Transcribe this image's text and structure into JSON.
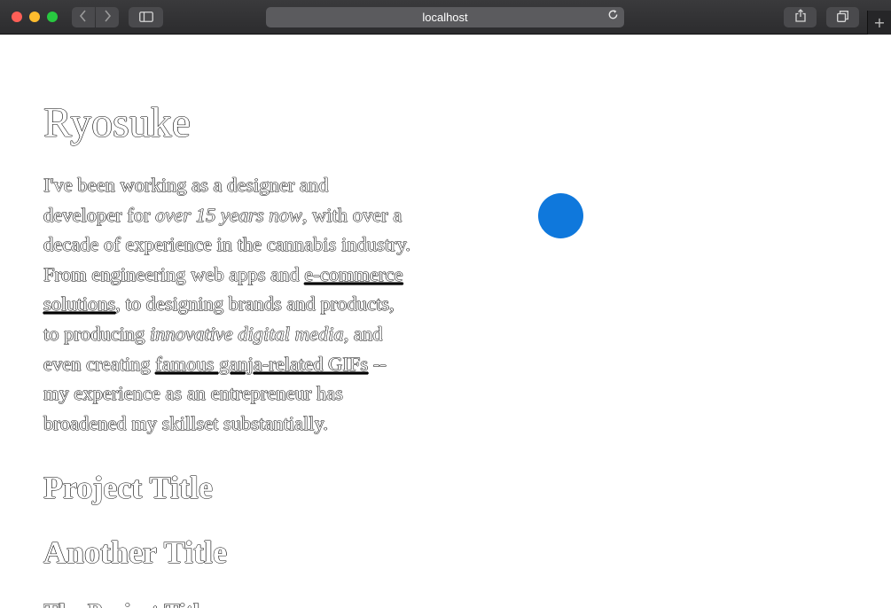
{
  "browser": {
    "address": "localhost"
  },
  "icons": {
    "back": "chevron-left-icon",
    "forward": "chevron-right-icon",
    "sidebar": "sidebar-icon",
    "reload": "reload-icon",
    "share": "share-icon",
    "tabs": "tab-overview-icon",
    "new_tab": "plus-icon"
  },
  "colors": {
    "accent_dot": "#0f78dc",
    "close": "#ff5f57",
    "minimize": "#febc2e",
    "zoom": "#28c840"
  },
  "page": {
    "title": "Ryosuke",
    "bio_lines": [
      {
        "a": "I've been working as a designer and"
      },
      {
        "a": "developer for ",
        "em": "over 15 years now",
        "b": ", with over a"
      },
      {
        "a": "decade of experience in the cannabis industry."
      },
      {
        "a": "From engineering web apps and ",
        "link": "e-commerce"
      },
      {
        "link": "solutions",
        "a": ", to designing brands and products,"
      },
      {
        "a": "to producing ",
        "em": "innovative digital media",
        "b": ", and"
      },
      {
        "a": "even creating ",
        "link": "famous ganja-related GIFs",
        "b": " --"
      },
      {
        "a": "my experience as an entrepreneur has"
      },
      {
        "a": "broadened my skillset substantially."
      }
    ],
    "heading_1": "Project Title",
    "heading_2": "Another Title",
    "heading_3_partial": "The Project Title"
  }
}
